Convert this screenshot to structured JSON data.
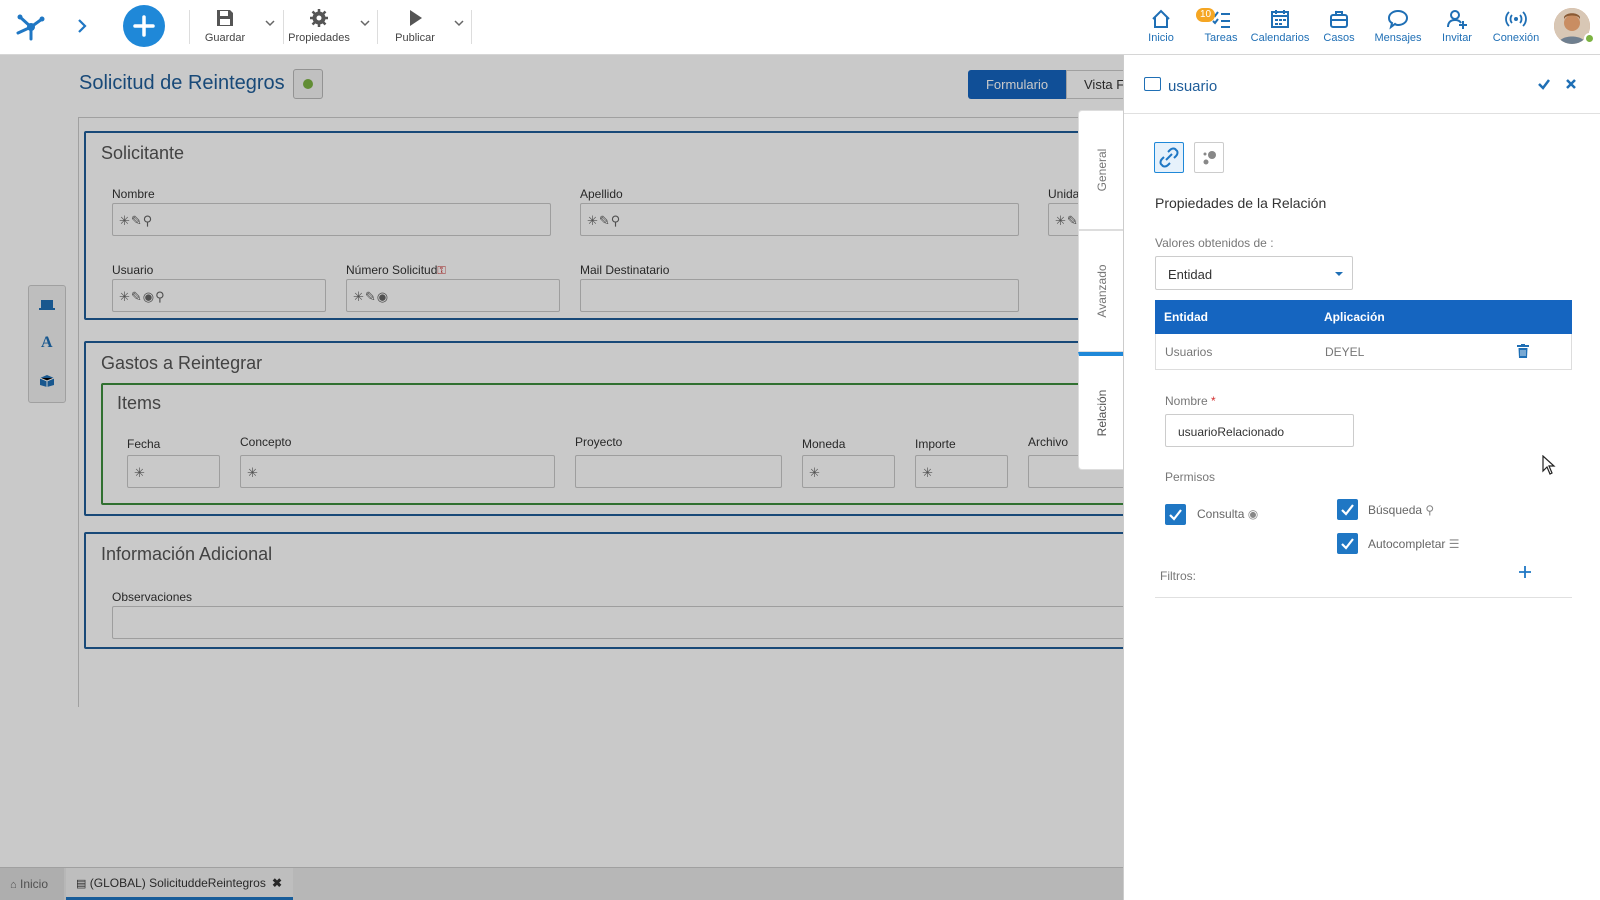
{
  "toolbar": {
    "save_label": "Guardar",
    "properties_label": "Propiedades",
    "publish_label": "Publicar"
  },
  "nav": {
    "inicio": "Inicio",
    "tareas": "Tareas",
    "tareas_badge": "10",
    "calendarios": "Calendarios",
    "casos": "Casos",
    "mensajes": "Mensajes",
    "invitar": "Invitar",
    "conexion": "Conexión"
  },
  "form": {
    "title": "Solicitud de Reintegros",
    "view_tabs": [
      "Formulario",
      "Vista F"
    ],
    "section1": {
      "title": "Solicitante",
      "labels": [
        "Nombre",
        "Apellido",
        "Unida",
        "Usuario",
        "Número Solicitud",
        "Mail Destinatario"
      ]
    },
    "section2": {
      "title": "Gastos a Reintegrar",
      "grid_title": "Items",
      "columns": [
        "Fecha",
        "Concepto",
        "Proyecto",
        "Moneda",
        "Importe",
        "Archivo"
      ]
    },
    "section3": {
      "title": "Información Adicional",
      "labels": [
        "Observaciones"
      ]
    }
  },
  "side_tabs": [
    "General",
    "Avanzado",
    "Relación"
  ],
  "bottom_tabs": {
    "home": "Inicio",
    "doc": "(GLOBAL) SolicituddeReintegros"
  },
  "right_panel": {
    "title": "usuario",
    "section_title": "Propiedades de la Relación",
    "values_from_label": "Valores obtenidos de :",
    "values_from_value": "Entidad",
    "table": {
      "headers": [
        "Entidad",
        "Aplicación"
      ],
      "rows": [
        {
          "entidad": "Usuarios",
          "aplicacion": "DEYEL"
        }
      ]
    },
    "name_label": "Nombre",
    "required_mark": "*",
    "name_value": "usuarioRelacionado",
    "permisos_label": "Permisos",
    "permisos": [
      {
        "label": "Consulta",
        "checked": true
      },
      {
        "label": "Búsqueda",
        "checked": true
      },
      {
        "label": "Autocompletar",
        "checked": true
      }
    ],
    "filtros_label": "Filtros:"
  },
  "colors": {
    "accent": "#1f77c4",
    "header_blue": "#1565c0",
    "panel_border": "#1f5d99",
    "items_border": "#3d8f3d",
    "status_dot": "#7cb342",
    "badge": "#f5a623"
  }
}
